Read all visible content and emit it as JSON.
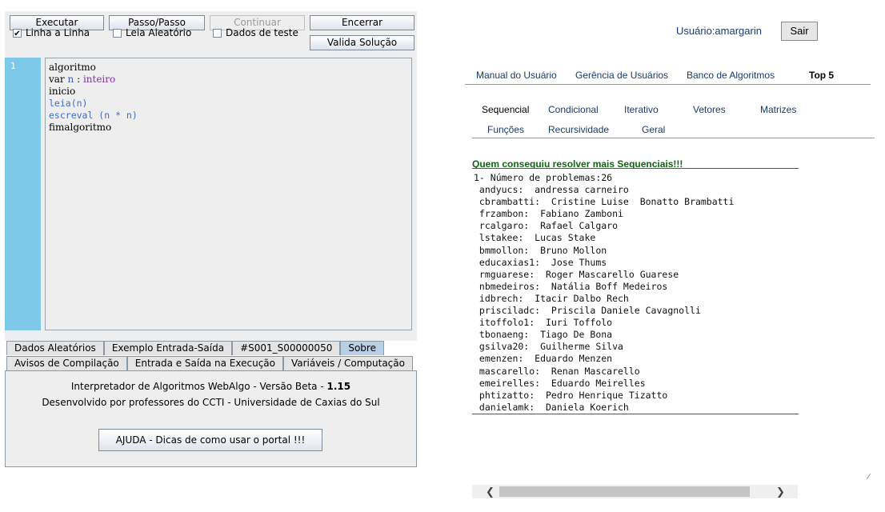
{
  "toolbar": {
    "executar": "Executar",
    "passo": "Passo/Passo",
    "continuar": "Continuar",
    "encerrar": "Encerrar",
    "linha_a_linha": "Linha a Linha",
    "leia_aleatorio": "Leia Aleatório",
    "dados_teste": "Dados de teste",
    "valida": "Valida Solução"
  },
  "checks": {
    "linha_a_linha": true,
    "leia_aleatorio": false,
    "dados_teste": false
  },
  "editor": {
    "line_number": "1",
    "lines": [
      "algoritmo",
      "var",
      "n",
      ":",
      "inteiro",
      "inicio",
      "leia(n)",
      "escreval (n * n)",
      "fimalgoritmo"
    ]
  },
  "tabs_row1": [
    "Dados Aleatórios",
    "Exemplo Entrada-Saída",
    "#S001_S00000050",
    "Sobre"
  ],
  "tabs_row2": [
    "Avisos de Compilação",
    "Entrada e Saída na Execução",
    "Variáveis / Computação"
  ],
  "about": {
    "line1": "Interpretador de Algoritmos WebAlgo - Versão Beta - ",
    "version": "1.15",
    "line2": "Desenvolvido por professores do CCTI - Universidade de Caxias do Sul",
    "help_button": "AJUDA - Dicas de como usar o portal !!!"
  },
  "header": {
    "user": "Usuário:amargarin",
    "logout": "Sair"
  },
  "topnav": [
    "Manual do Usuário",
    "Gerência de Usuários",
    "Banco de Algoritmos",
    "Top 5"
  ],
  "categories_row1": [
    "Sequencial",
    "Condicional",
    "Iterativo",
    "Vetores",
    "Matrizes"
  ],
  "categories_row2": [
    "Funções",
    "Recursividade",
    "Geral"
  ],
  "ranking": {
    "title": "Quem conseguiu resolver mais Sequenciais!!!",
    "lines": [
      "1- Número de problemas:26",
      " andyucs:  andressa carneiro",
      " cbrambatti:  Cristine Luise  Bonatto Brambatti",
      " frzambon:  Fabiano Zamboni",
      " rcalgaro:  Rafael Calgaro",
      " lstakee:  Lucas Stake",
      " bmmollon:  Bruno Mollon",
      " educaxias1:  Jose Thums",
      " rmguarese:  Roger Mascarello Guarese",
      " nbmedeiros:  Natália Boff Medeiros",
      " idbrech:  Itacir Dalbo Rech",
      " prisciladc:  Priscila Daniele Cavagnolli",
      " itoffolo1:  Iuri Toffolo",
      " tbonaeng:  Tiago De Bona",
      " gsilva20:  Guilherme Silva",
      " emenzen:  Eduardo Menzen",
      " mascarello:  Renan Mascarello",
      " emeirelles:  Eduardo Meirelles",
      " phtizatto:  Pedro Henrique Tizatto",
      " danielamk:  Daniela Koerich"
    ]
  },
  "colors": {
    "gutter": "#7ec8ea",
    "active_tab": "#b8cfe5",
    "ranking_title": "#0a6a0a",
    "link": "#1a3a6b"
  }
}
